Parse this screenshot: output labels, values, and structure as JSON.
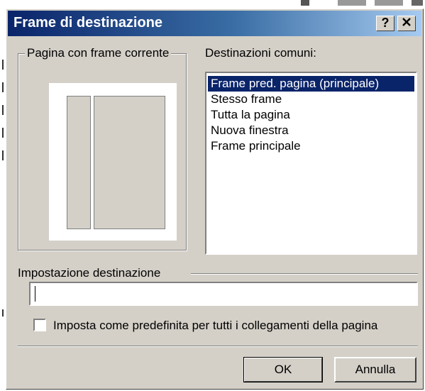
{
  "window": {
    "title": "Frame di destinazione",
    "help_button": "?",
    "close_button": "✕"
  },
  "preview_group": {
    "label": "Pagina con frame corrente",
    "mnemonic": "P"
  },
  "common_targets": {
    "label": "Destinazioni comuni:",
    "mnemonic": "D",
    "items": [
      "Frame pred. pagina (principale)",
      "Stesso frame",
      "Tutta la pagina",
      "Nuova finestra",
      "Frame principale"
    ],
    "selected_index": 0
  },
  "target_setting": {
    "label": "Impostazione destinazione",
    "mnemonic": "I",
    "value": ""
  },
  "default_checkbox": {
    "label": "Imposta come predefinita per tutti i collegamenti della pagina",
    "checked": false
  },
  "buttons": {
    "ok": "OK",
    "cancel": "Annulla"
  },
  "colors": {
    "face": "#d4d0c8",
    "title_start": "#0a246a",
    "title_end": "#a6caf0",
    "selection": "#0a246a"
  }
}
